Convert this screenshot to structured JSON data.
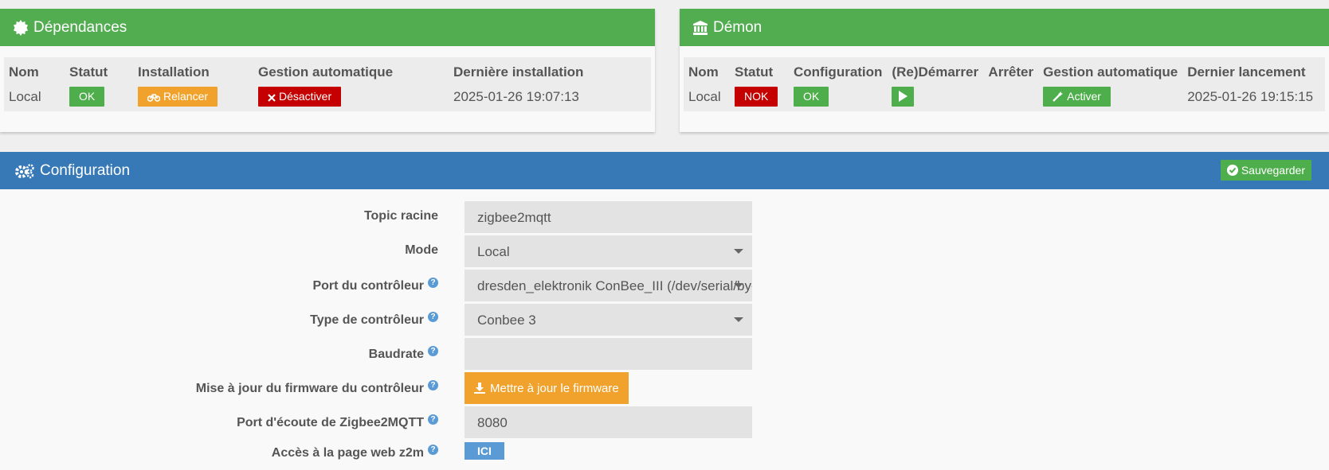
{
  "deps": {
    "title": "Dépendances",
    "headers": [
      "Nom",
      "Statut",
      "Installation",
      "Gestion automatique",
      "Dernière installation"
    ],
    "nom": "Local",
    "statut": "OK",
    "relancer": "Relancer",
    "desactiver": "Désactiver",
    "last": "2025-01-26 19:07:13"
  },
  "demon": {
    "title": "Démon",
    "headers": [
      "Nom",
      "Statut",
      "Configuration",
      "(Re)Démarrer",
      "Arrêter",
      "Gestion automatique",
      "Dernier lancement"
    ],
    "nom": "Local",
    "statut": "NOK",
    "config": "OK",
    "activer": "Activer",
    "last": "2025-01-26 19:15:15"
  },
  "config": {
    "title": "Configuration",
    "save": "Sauvegarder",
    "rows": [
      {
        "label": "Topic racine",
        "value": "zigbee2mqtt"
      },
      {
        "label": "Mode",
        "value": "Local"
      },
      {
        "label": "Port du contrôleur",
        "value": "dresden_elektronik ConBee_III (/dev/serial/by-id/"
      },
      {
        "label": "Type de contrôleur",
        "value": "Conbee 3"
      },
      {
        "label": "Baudrate",
        "value": ""
      },
      {
        "label": "Mise à jour du firmware du contrôleur",
        "value": "Mettre à jour le firmware"
      },
      {
        "label": "Port d'écoute de Zigbee2MQTT",
        "value": "8080"
      },
      {
        "label": "Accès à la page web z2m",
        "value": "ICI"
      }
    ]
  },
  "colors": {
    "green": "#52ad51",
    "blue": "#3779b7",
    "orange": "#f0a22c",
    "red": "#c40000",
    "help": "#5a9bd5"
  }
}
